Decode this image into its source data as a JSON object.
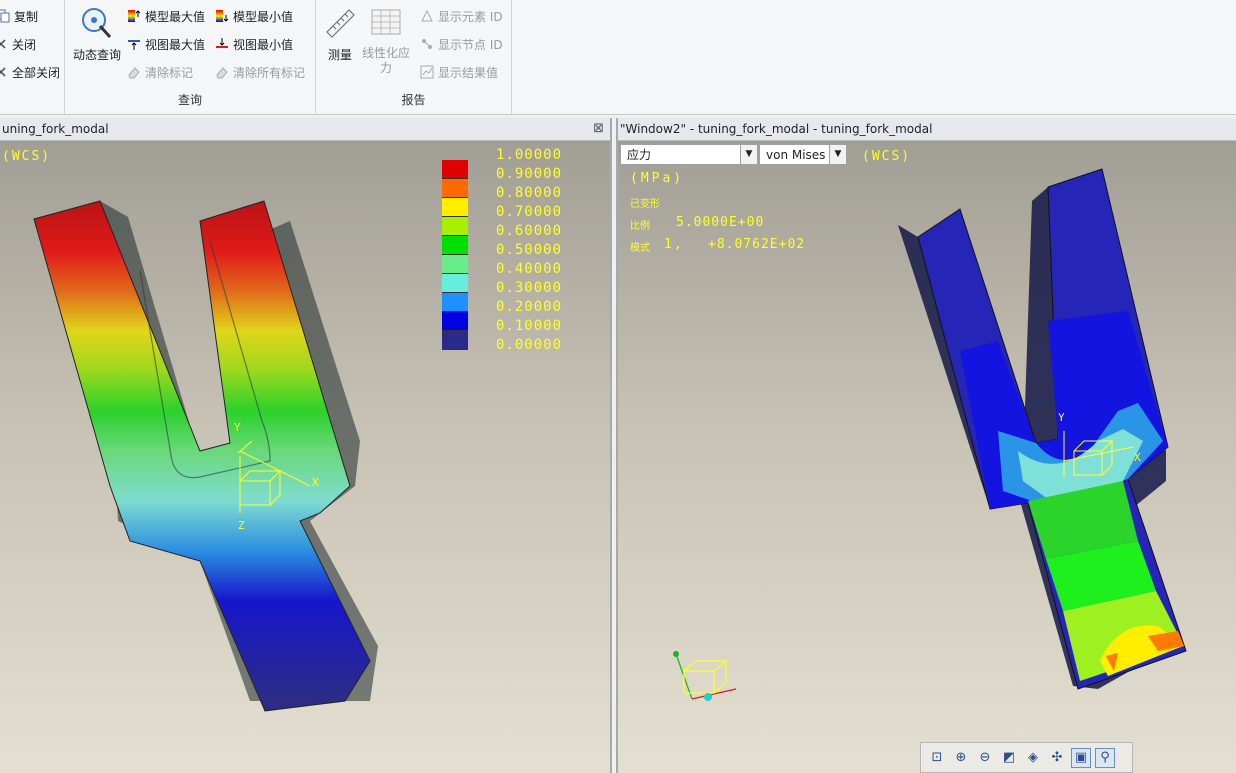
{
  "ribbon": {
    "window_group": {
      "copy": "复制",
      "close": "关闭",
      "close_all": "全部关闭"
    },
    "query_group": {
      "label": "查询",
      "dynamic_query": "动态查询",
      "model_max": "模型最大值",
      "model_min": "模型最小值",
      "view_max": "视图最大值",
      "view_min": "视图最小值",
      "clear_marks": "清除标记",
      "clear_all_marks": "清除所有标记"
    },
    "report_group": {
      "label": "报告",
      "measure": "测量",
      "linearized_stress": "线性化应力",
      "show_element_id": "显示元素 ID",
      "show_node_id": "显示节点 ID",
      "show_result_value": "显示结果值"
    }
  },
  "left_window": {
    "title": "uning_fork_modal",
    "wcs": "(WCS)",
    "axis_labels": {
      "y": "Y",
      "x": "X",
      "z": "Z"
    },
    "legend": {
      "values": [
        "1.00000",
        "0.90000",
        "0.80000",
        "0.70000",
        "0.60000",
        "0.50000",
        "0.40000",
        "0.30000",
        "0.20000",
        "0.10000",
        "0.00000"
      ],
      "colors": [
        "#e00000",
        "#ff6a00",
        "#ffee00",
        "#a8f000",
        "#00e000",
        "#66ee88",
        "#66eedd",
        "#1e90ff",
        "#0000e0",
        "#2a2a8c"
      ]
    }
  },
  "right_window": {
    "title": "\"Window2\" - tuning_fork_modal - tuning_fork_modal",
    "quantity_select": "应力",
    "component_select": "von Mises",
    "wcs": "(WCS)",
    "unit": "(MPa)",
    "deformed": "已变形",
    "scale_label": "比例",
    "scale_value": "5.0000E+00",
    "mode_label": "模式",
    "mode_value": "1,",
    "mode_freq": "+8.0762E+02",
    "axis_labels": {
      "y": "Y",
      "x": "X"
    }
  }
}
